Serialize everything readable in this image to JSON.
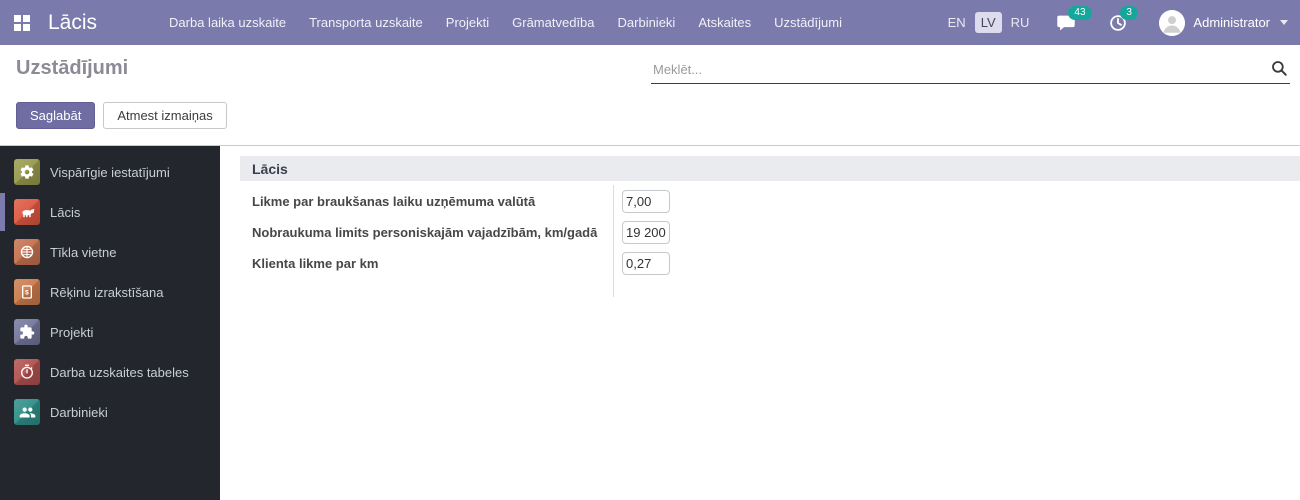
{
  "topbar": {
    "brand": "Lācis",
    "nav_items": [
      "Darba laika uzskaite",
      "Transporta uzskaite",
      "Projekti",
      "Grāmatvedība",
      "Darbinieki",
      "Atskaites",
      "Uzstādījumi"
    ],
    "languages": [
      {
        "code": "EN",
        "active": false
      },
      {
        "code": "LV",
        "active": true
      },
      {
        "code": "RU",
        "active": false
      }
    ],
    "messages_badge": "43",
    "activities_badge": "3",
    "user_name": "Administrator"
  },
  "page": {
    "title": "Uzstādījumi",
    "search_placeholder": "Meklēt...",
    "save_button": "Saglabāt",
    "discard_button": "Atmest izmaiņas"
  },
  "sidebar": {
    "items": [
      {
        "label": "Vispārīgie iestatījumi",
        "icon": "gear-icon",
        "color": "#98994c",
        "active": false
      },
      {
        "label": "Lācis",
        "icon": "bear-icon",
        "color": "#dd5740",
        "active": true
      },
      {
        "label": "Tīkla vietne",
        "icon": "globe-icon",
        "color": "#c3714e",
        "active": false
      },
      {
        "label": "Rēķinu izrakstīšana",
        "icon": "invoice-icon",
        "color": "#cb7b4b",
        "active": false
      },
      {
        "label": "Projekti",
        "icon": "puzzle-icon",
        "color": "#73769a",
        "active": false
      },
      {
        "label": "Darba uzskaites tabeles",
        "icon": "stopwatch-icon",
        "color": "#b0504d",
        "active": false
      },
      {
        "label": "Darbinieki",
        "icon": "people-icon",
        "color": "#2e8e87",
        "active": false
      }
    ]
  },
  "main": {
    "section_title": "Lācis",
    "fields": [
      {
        "label": "Likme par braukšanas laiku uzņēmuma valūtā",
        "value": "7,00"
      },
      {
        "label": "Nobraukuma limits personiskajām vajadzībām, km/gadā",
        "value": "19 200"
      },
      {
        "label": "Klienta likme par km",
        "value": "0,27"
      }
    ]
  },
  "colors": {
    "topbar_bg": "#7b7aac",
    "accent": "#7c7bad",
    "badge": "#16a79b",
    "primary_button_bg": "#6f6da1",
    "sidebar_bg": "#23272d"
  }
}
